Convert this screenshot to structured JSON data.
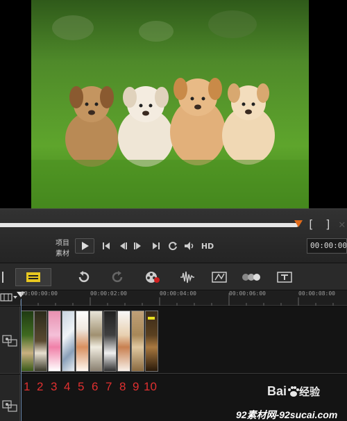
{
  "player": {
    "mode_project": "项目",
    "mode_clip": "素材",
    "hd_label": "HD",
    "bracket_in": "[",
    "bracket_out": "]",
    "timecode": "00:00:00"
  },
  "ruler": {
    "ticks": [
      "00:00:00:00",
      "00:00:02:00",
      "00:00:04:00",
      "00:00:06:00",
      "00:00:08:00"
    ]
  },
  "clip_numbers": [
    "1",
    "2",
    "3",
    "4",
    "5",
    "6",
    "7",
    "8",
    "9",
    "10"
  ],
  "watermark": {
    "baidu": "Bai",
    "baidu_suffix": "经验",
    "site": "92素材网-92sucai.com"
  },
  "colors": {
    "accent_orange": "#e06a1a",
    "annotation_red": "#e03030"
  }
}
